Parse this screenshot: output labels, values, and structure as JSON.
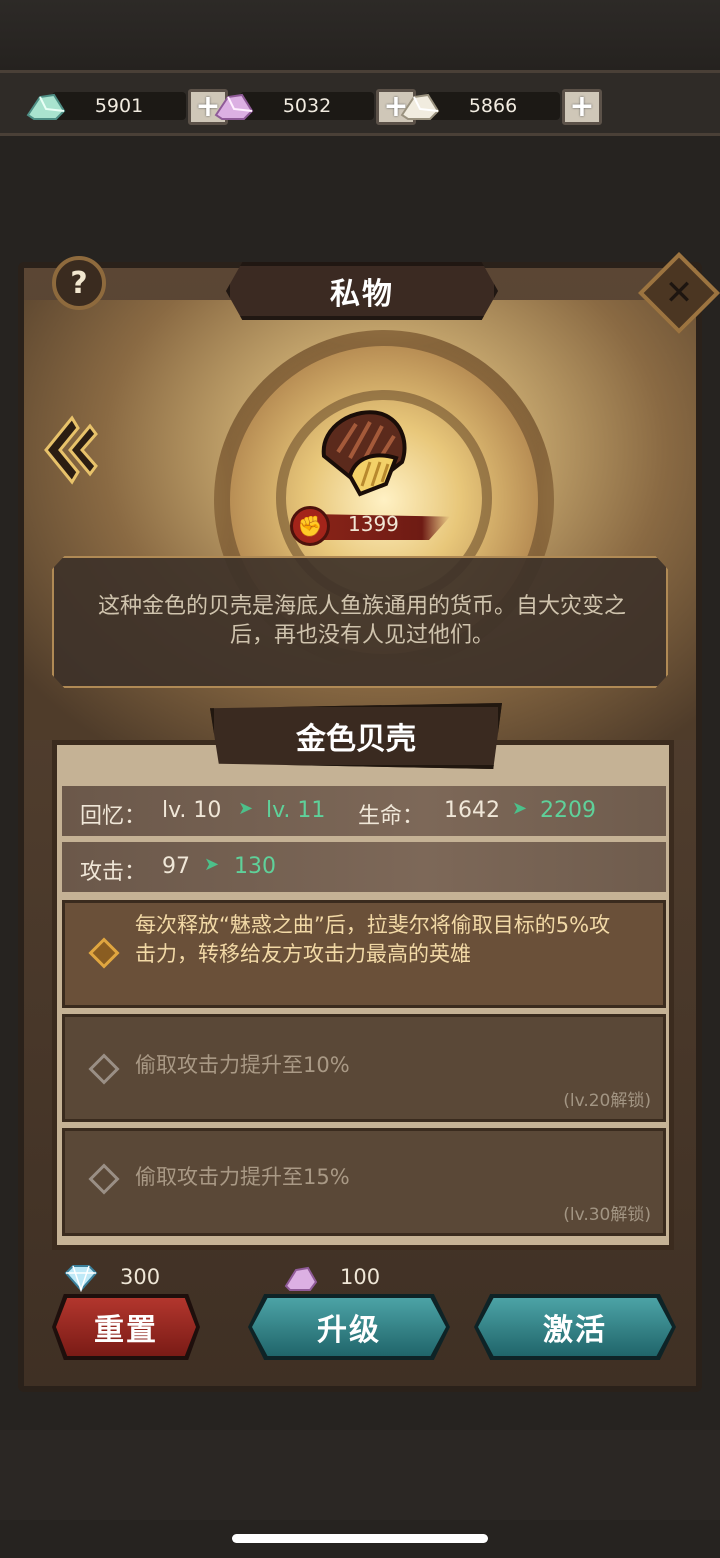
{
  "currencies": [
    {
      "icon": "green-shard-icon",
      "value": "5901",
      "color": "#9ed6c2"
    },
    {
      "icon": "pink-shard-icon",
      "value": "5032",
      "color": "#d7a6dd"
    },
    {
      "icon": "white-shard-icon",
      "value": "5866",
      "color": "#ece6d6"
    }
  ],
  "plus_label": "+",
  "panel": {
    "title": "私物",
    "help_label": "?",
    "close_label": "✕"
  },
  "item": {
    "power": "1399",
    "description": "这种金色的贝壳是海底人鱼族通用的货币。自大灾变之后，再也没有人见过他们。",
    "name": "金色贝壳"
  },
  "stats": {
    "memory": {
      "label": "回忆：",
      "from": "lv. 10",
      "to": "lv. 11"
    },
    "hp": {
      "label": "生命：",
      "from": "1642",
      "to": "2209"
    },
    "attack": {
      "label": "攻击：",
      "from": "97",
      "to": "130"
    }
  },
  "skills": [
    {
      "text": "每次释放“魅惑之曲”后，拉斐尔将偷取目标的5%攻击力，转移给友方攻击力最高的英雄",
      "unlock": "",
      "active": true
    },
    {
      "text": "偷取攻击力提升至10%",
      "unlock": "(lv.20解锁)",
      "active": false
    },
    {
      "text": "偷取攻击力提升至15%",
      "unlock": "(lv.30解锁)",
      "active": false
    }
  ],
  "costs": {
    "reset": {
      "icon": "diamond-icon",
      "value": "300"
    },
    "upgrade": {
      "icon": "pink-shard-icon",
      "value": "100"
    }
  },
  "buttons": {
    "reset": "重置",
    "upgrade": "升级",
    "activate": "激活"
  },
  "colors": {
    "accent_green": "#5fd19a",
    "reset_red": "#b2362d",
    "teal": "#4ca3a6"
  }
}
